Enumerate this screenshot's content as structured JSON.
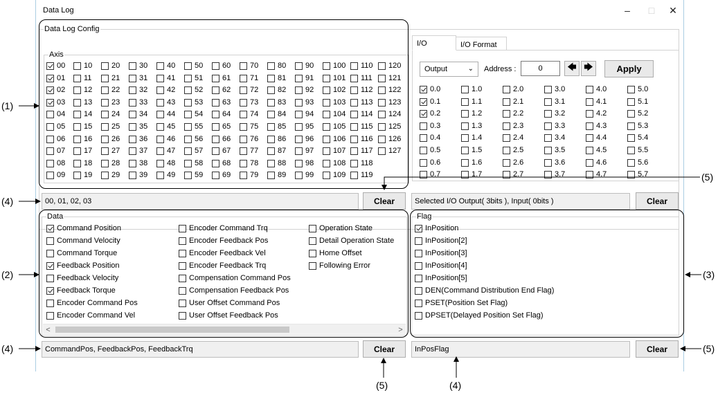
{
  "window": {
    "title": "Data Log",
    "minimize_glyph": "–",
    "maximize_glyph": "□",
    "close_glyph": "✕"
  },
  "config": {
    "legend": "Data Log Config",
    "axis_legend": "Axis",
    "axis_rows": [
      [
        "00",
        "10",
        "20",
        "30",
        "40",
        "50",
        "60",
        "70",
        "80",
        "90",
        "100",
        "110",
        "120"
      ],
      [
        "01",
        "11",
        "21",
        "31",
        "41",
        "51",
        "61",
        "71",
        "81",
        "91",
        "101",
        "111",
        "121"
      ],
      [
        "02",
        "12",
        "22",
        "32",
        "42",
        "52",
        "62",
        "72",
        "82",
        "92",
        "102",
        "112",
        "122"
      ],
      [
        "03",
        "13",
        "23",
        "33",
        "43",
        "53",
        "63",
        "73",
        "83",
        "93",
        "103",
        "113",
        "123"
      ],
      [
        "04",
        "14",
        "24",
        "34",
        "44",
        "54",
        "64",
        "74",
        "84",
        "94",
        "104",
        "114",
        "124"
      ],
      [
        "05",
        "15",
        "25",
        "35",
        "45",
        "55",
        "65",
        "75",
        "85",
        "95",
        "105",
        "115",
        "125"
      ],
      [
        "06",
        "16",
        "26",
        "36",
        "46",
        "56",
        "66",
        "76",
        "86",
        "96",
        "106",
        "116",
        "126"
      ],
      [
        "07",
        "17",
        "27",
        "37",
        "47",
        "57",
        "67",
        "77",
        "87",
        "97",
        "107",
        "117",
        "127"
      ],
      [
        "08",
        "18",
        "28",
        "38",
        "48",
        "58",
        "68",
        "78",
        "88",
        "98",
        "108",
        "118"
      ],
      [
        "09",
        "19",
        "29",
        "39",
        "49",
        "59",
        "69",
        "79",
        "89",
        "99",
        "109",
        "119"
      ]
    ],
    "checked_axes": [
      "00",
      "01",
      "02",
      "03"
    ],
    "axis_summary": "00, 01, 02, 03",
    "clear_label": "Clear"
  },
  "io": {
    "tabs": [
      "I/O",
      "I/O Format"
    ],
    "active_tab": "I/O",
    "mode_value": "Output",
    "address_label": "Address :",
    "address_value": "0",
    "prev_glyph": "🡄",
    "next_glyph": "🡆",
    "apply_label": "Apply",
    "bit_columns": [
      [
        "0.0",
        "0.1",
        "0.2",
        "0.3",
        "0.4",
        "0.5",
        "0.6",
        "0.7"
      ],
      [
        "1.0",
        "1.1",
        "1.2",
        "1.3",
        "1.4",
        "1.5",
        "1.6",
        "1.7"
      ],
      [
        "2.0",
        "2.1",
        "2.2",
        "2.3",
        "2.4",
        "2.5",
        "2.6",
        "2.7"
      ],
      [
        "3.0",
        "3.1",
        "3.2",
        "3.3",
        "3.4",
        "3.5",
        "3.6",
        "3.7"
      ],
      [
        "4.0",
        "4.1",
        "4.2",
        "4.3",
        "4.4",
        "4.5",
        "4.6",
        "4.7"
      ],
      [
        "5.0",
        "5.1",
        "5.2",
        "5.3",
        "5.4",
        "5.5",
        "5.6",
        "5.7"
      ]
    ],
    "checked_bits": [
      "0.0",
      "0.1",
      "0.2"
    ],
    "summary": "Selected I/O Output( 3bits ), Input( 0bits )",
    "clear_label": "Clear"
  },
  "data": {
    "legend": "Data",
    "col1": [
      {
        "label": "Command Position",
        "checked": true
      },
      {
        "label": "Command Velocity",
        "checked": false
      },
      {
        "label": "Command Torque",
        "checked": false
      },
      {
        "label": "Feedback Position",
        "checked": true
      },
      {
        "label": "Feedback Velocity",
        "checked": false
      },
      {
        "label": "Feedback Torque",
        "checked": true
      },
      {
        "label": "Encoder Command Pos",
        "checked": false
      },
      {
        "label": "Encoder Command Vel",
        "checked": false
      }
    ],
    "col2": [
      {
        "label": "Encoder Command Trq",
        "checked": false
      },
      {
        "label": "Encoder Feedback Pos",
        "checked": false
      },
      {
        "label": "Encoder Feedback Vel",
        "checked": false
      },
      {
        "label": "Encoder Feedback Trq",
        "checked": false
      },
      {
        "label": "Compensation Command Pos",
        "checked": false
      },
      {
        "label": "Compensation Feedback Pos",
        "checked": false
      },
      {
        "label": "User Offset Command Pos",
        "checked": false
      },
      {
        "label": "User Offset Feedback Pos",
        "checked": false
      }
    ],
    "col3": [
      {
        "label": "Operation State",
        "checked": false
      },
      {
        "label": "Detail Operation State",
        "checked": false
      },
      {
        "label": "Home Offset",
        "checked": false
      },
      {
        "label": "Following Error",
        "checked": false
      }
    ],
    "summary": "CommandPos, FeedbackPos, FeedbackTrq",
    "clear_label": "Clear",
    "scroll_left": "<",
    "scroll_right": ">"
  },
  "flag": {
    "legend": "Flag",
    "items": [
      {
        "label": "InPosition",
        "checked": true
      },
      {
        "label": "InPosition[2]",
        "checked": false
      },
      {
        "label": "InPosition[3]",
        "checked": false
      },
      {
        "label": "InPosition[4]",
        "checked": false
      },
      {
        "label": "InPosition[5]",
        "checked": false
      },
      {
        "label": "DEN(Command Distribution End Flag)",
        "checked": false
      },
      {
        "label": "PSET(Position Set Flag)",
        "checked": false
      },
      {
        "label": "DPSET(Delayed Position Set Flag)",
        "checked": false
      }
    ],
    "summary": "InPosFlag",
    "clear_label": "Clear"
  },
  "callouts": {
    "c1": "(1)",
    "c2": "(2)",
    "c3": "(3)",
    "c4a": "(4)",
    "c4b": "(4)",
    "c4c": "(4)",
    "c5a": "(5)",
    "c5b": "(5)",
    "c5c": "(5)"
  }
}
